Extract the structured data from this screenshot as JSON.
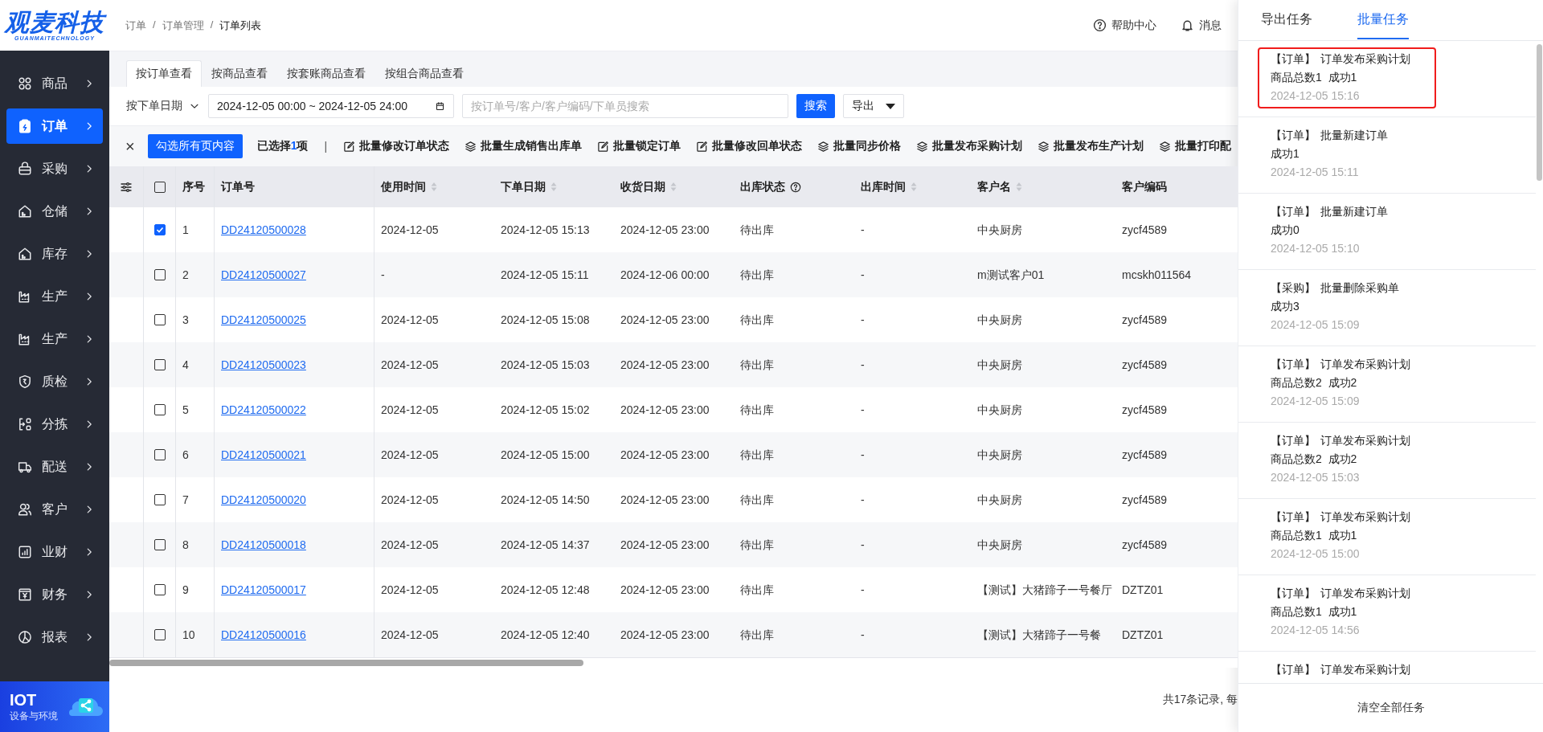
{
  "logo": {
    "name": "观麦科技",
    "tagline": "GUANMAITECHNOLOGY"
  },
  "sidebar": {
    "items": [
      {
        "label": "商品",
        "selected": false
      },
      {
        "label": "订单",
        "selected": true
      },
      {
        "label": "采购",
        "selected": false
      },
      {
        "label": "仓储",
        "selected": false
      },
      {
        "label": "库存",
        "selected": false
      },
      {
        "label": "生产",
        "selected": false
      },
      {
        "label": "生产",
        "selected": false
      },
      {
        "label": "质检",
        "selected": false
      },
      {
        "label": "分拣",
        "selected": false
      },
      {
        "label": "配送",
        "selected": false
      },
      {
        "label": "客户",
        "selected": false
      },
      {
        "label": "业财",
        "selected": false
      },
      {
        "label": "财务",
        "selected": false
      },
      {
        "label": "报表",
        "selected": false
      }
    ],
    "banner": {
      "title": "IOT",
      "subtitle": "设备与环境"
    }
  },
  "header": {
    "breadcrumb": [
      "订单",
      "订单管理",
      "订单列表"
    ],
    "separator": "/",
    "links": [
      "帮助中心",
      "消息"
    ]
  },
  "view_tabs": [
    {
      "label": "按订单查看",
      "selected": true
    },
    {
      "label": "按商品查看",
      "selected": false
    },
    {
      "label": "按套账商品查看",
      "selected": false
    },
    {
      "label": "按组合商品查看",
      "selected": false
    }
  ],
  "filter": {
    "date_type": "按下单日期",
    "date_range": "2024-12-05 00:00 ~ 2024-12-05 24:00",
    "search_placeholder": "按订单号/客户/客户编码/下单员搜索",
    "search_button": "搜索",
    "export_button": "导出"
  },
  "batch_bar": {
    "close": "×",
    "select_all": "勾选所有页内容",
    "selected_text": "已选择**1**项",
    "divider": "|",
    "actions": [
      "批量修改订单状态",
      "批量生成销售出库单",
      "批量锁定订单",
      "批量修改回单状态",
      "批量同步价格",
      "批量发布采购计划",
      "批量发布生产计划",
      "批量打印配"
    ]
  },
  "table": {
    "all_checked": false,
    "columns": [
      {
        "label": "序号",
        "sortable": false,
        "hint": false
      },
      {
        "label": "订单号",
        "sortable": false,
        "hint": false
      },
      {
        "label": "使用时间",
        "sortable": true,
        "hint": false
      },
      {
        "label": "下单日期",
        "sortable": true,
        "hint": false
      },
      {
        "label": "收货日期",
        "sortable": true,
        "hint": false
      },
      {
        "label": "出库状态",
        "sortable": false,
        "hint": true
      },
      {
        "label": "出库时间",
        "sortable": true,
        "hint": false
      },
      {
        "label": "客户名",
        "sortable": true,
        "hint": false
      },
      {
        "label": "客户编码",
        "sortable": false,
        "hint": false
      }
    ],
    "rows": [
      {
        "checked": true,
        "cells": [
          "1",
          "DD24120500028",
          "2024-12-05",
          "2024-12-05 15:13",
          "2024-12-05 23:00",
          "待出库",
          "-",
          "中央厨房",
          "zycf4589"
        ]
      },
      {
        "checked": false,
        "cells": [
          "2",
          "DD24120500027",
          "-",
          "2024-12-05 15:11",
          "2024-12-06 00:00",
          "待出库",
          "-",
          "m测试客户01",
          "mcskh011564"
        ]
      },
      {
        "checked": false,
        "cells": [
          "3",
          "DD24120500025",
          "2024-12-05",
          "2024-12-05 15:08",
          "2024-12-05 23:00",
          "待出库",
          "-",
          "中央厨房",
          "zycf4589"
        ]
      },
      {
        "checked": false,
        "cells": [
          "4",
          "DD24120500023",
          "2024-12-05",
          "2024-12-05 15:03",
          "2024-12-05 23:00",
          "待出库",
          "-",
          "中央厨房",
          "zycf4589"
        ]
      },
      {
        "checked": false,
        "cells": [
          "5",
          "DD24120500022",
          "2024-12-05",
          "2024-12-05 15:02",
          "2024-12-05 23:00",
          "待出库",
          "-",
          "中央厨房",
          "zycf4589"
        ]
      },
      {
        "checked": false,
        "cells": [
          "6",
          "DD24120500021",
          "2024-12-05",
          "2024-12-05 15:00",
          "2024-12-05 23:00",
          "待出库",
          "-",
          "中央厨房",
          "zycf4589"
        ]
      },
      {
        "checked": false,
        "cells": [
          "7",
          "DD24120500020",
          "2024-12-05",
          "2024-12-05 14:50",
          "2024-12-05 23:00",
          "待出库",
          "-",
          "中央厨房",
          "zycf4589"
        ]
      },
      {
        "checked": false,
        "cells": [
          "8",
          "DD24120500018",
          "2024-12-05",
          "2024-12-05 14:37",
          "2024-12-05 23:00",
          "待出库",
          "-",
          "中央厨房",
          "zycf4589"
        ]
      },
      {
        "checked": false,
        "cells": [
          "9",
          "DD24120500017",
          "2024-12-05",
          "2024-12-05 12:48",
          "2024-12-05 23:00",
          "待出库",
          "-",
          "【测试】大猪蹄子一号餐厅",
          "DZTZ01"
        ]
      },
      {
        "checked": false,
        "cells": [
          "10",
          "DD24120500016",
          "2024-12-05",
          "2024-12-05 12:40",
          "2024-12-05 23:00",
          "待出库",
          "-",
          "【测试】大猪蹄子一号餐",
          "DZTZ01"
        ]
      }
    ],
    "footer": "共17条记录, 每"
  },
  "task_panel": {
    "tabs": [
      {
        "label": "导出任务",
        "selected": false
      },
      {
        "label": "批量任务",
        "selected": true
      }
    ],
    "tasks": [
      {
        "tag": "【订单】",
        "title": "订单发布采购计划",
        "detail": "商品总数1  成功1",
        "time": "2024-12-05 15:16",
        "selected": true
      },
      {
        "tag": "【订单】",
        "title": "批量新建订单",
        "detail": "成功1",
        "time": "2024-12-05 15:11",
        "selected": false
      },
      {
        "tag": "【订单】",
        "title": "批量新建订单",
        "detail": "成功0",
        "time": "2024-12-05 15:10",
        "selected": false
      },
      {
        "tag": "【采购】",
        "title": "批量删除采购单",
        "detail": "成功3",
        "time": "2024-12-05 15:09",
        "selected": false
      },
      {
        "tag": "【订单】",
        "title": "订单发布采购计划",
        "detail": "商品总数2  成功2",
        "time": "2024-12-05 15:09",
        "selected": false
      },
      {
        "tag": "【订单】",
        "title": "订单发布采购计划",
        "detail": "商品总数2  成功2",
        "time": "2024-12-05 15:03",
        "selected": false
      },
      {
        "tag": "【订单】",
        "title": "订单发布采购计划",
        "detail": "商品总数1  成功1",
        "time": "2024-12-05 15:00",
        "selected": false
      },
      {
        "tag": "【订单】",
        "title": "订单发布采购计划",
        "detail": "商品总数1  成功1",
        "time": "2024-12-05 14:56",
        "selected": false
      },
      {
        "tag": "【订单】",
        "title": "订单发布采购计划",
        "selected": false
      }
    ],
    "clear_button": "清空全部任务"
  }
}
